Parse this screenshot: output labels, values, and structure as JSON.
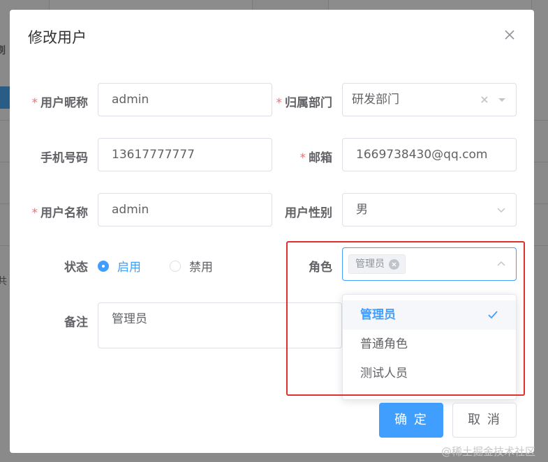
{
  "background": {
    "side_texts": [
      "刷",
      "共"
    ]
  },
  "dialog": {
    "title": "修改用户",
    "fields": {
      "nickname": {
        "label": "用户昵称",
        "value": "admin",
        "required": true
      },
      "department": {
        "label": "归属部门",
        "value": "研发部门",
        "required": true
      },
      "phone": {
        "label": "手机号码",
        "value": "13617777777",
        "required": false
      },
      "email": {
        "label": "邮箱",
        "value": "1669738430@qq.com",
        "required": true
      },
      "username": {
        "label": "用户名称",
        "value": "admin",
        "required": true
      },
      "gender": {
        "label": "用户性别",
        "value": "男",
        "required": false
      },
      "status": {
        "label": "状态",
        "options": [
          "启用",
          "禁用"
        ],
        "selected": "启用"
      },
      "role": {
        "label": "角色",
        "tags": [
          "管理员"
        ],
        "options": [
          "管理员",
          "普通角色",
          "测试人员"
        ],
        "selected": [
          "管理员"
        ]
      },
      "remark": {
        "label": "备注",
        "value": "管理员"
      }
    },
    "required_mark": "*",
    "buttons": {
      "confirm": "确 定",
      "cancel": "取 消"
    }
  },
  "colors": {
    "primary": "#409eff",
    "required": "#f56c6c",
    "highlight_border": "#e0302a",
    "overlay": "#7f7f7f"
  },
  "watermark": "@稀土掘金技术社区"
}
